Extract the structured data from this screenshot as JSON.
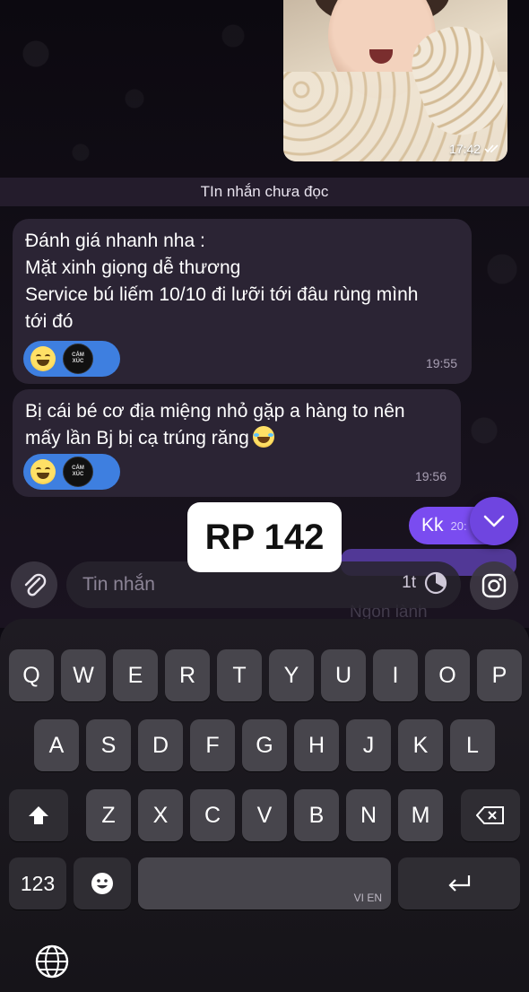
{
  "photo": {
    "time": "17:42"
  },
  "unread_divider": "TIn nhắn chưa đọc",
  "messages": [
    {
      "lines": [
        "Đánh giá nhanh nha :",
        "Mặt xinh giọng dễ thương",
        "Service bú liếm 10/10 đi lưỡi tới đâu rùng mình",
        "tới đó"
      ],
      "time": "19:55",
      "reaction_badge": [
        "CẢM",
        "XÚC"
      ]
    },
    {
      "lines": [
        "Bị cái bé cơ địa miệng nhỏ gặp a hàng to nên",
        "mấy lần Bj bị cạ trúng răng"
      ],
      "time": "19:56",
      "reaction_badge": [
        "CẢM",
        "XÚC"
      ]
    }
  ],
  "overlay_label": "RP 142",
  "outgoing": {
    "text": "Kk",
    "time": "20:"
  },
  "ghost_text": "Ngon lành",
  "input": {
    "placeholder": "Tin nhắn",
    "timer": "1t"
  },
  "keyboard": {
    "row1": [
      "Q",
      "W",
      "E",
      "R",
      "T",
      "Y",
      "U",
      "I",
      "O",
      "P"
    ],
    "row2": [
      "A",
      "S",
      "D",
      "F",
      "G",
      "H",
      "J",
      "K",
      "L"
    ],
    "row3": [
      "Z",
      "X",
      "C",
      "V",
      "B",
      "N",
      "M"
    ],
    "numbers_key": "123",
    "space_lang": "VI EN"
  },
  "icons": [
    "paperclip-icon",
    "timer-icon",
    "instagram-icon",
    "chevron-down-icon",
    "shift-icon",
    "backspace-icon",
    "emoji-icon",
    "return-icon",
    "globe-icon"
  ],
  "colors": {
    "accent": "#7a4cf0",
    "bubble": "#2b2434",
    "reaction": "#3e7fe0"
  }
}
